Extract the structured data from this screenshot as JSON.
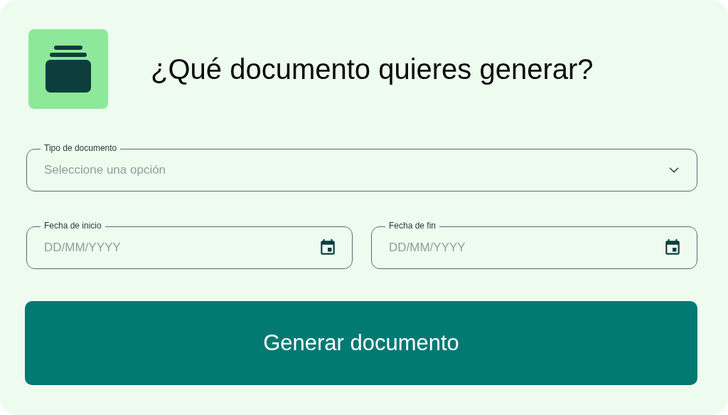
{
  "header": {
    "title": "¿Qué documento quieres generar?"
  },
  "fields": [
    {
      "kind": "select",
      "label": "Tipo de documento",
      "placeholder": "Seleccione una opción"
    }
  ],
  "date_fields": [
    {
      "label": "Fecha de inicio",
      "placeholder": "DD/MM/YYYY"
    },
    {
      "label": "Fecha de fin",
      "placeholder": "DD/MM/YYYY"
    }
  ],
  "submit": {
    "label": "Generar documento"
  }
}
